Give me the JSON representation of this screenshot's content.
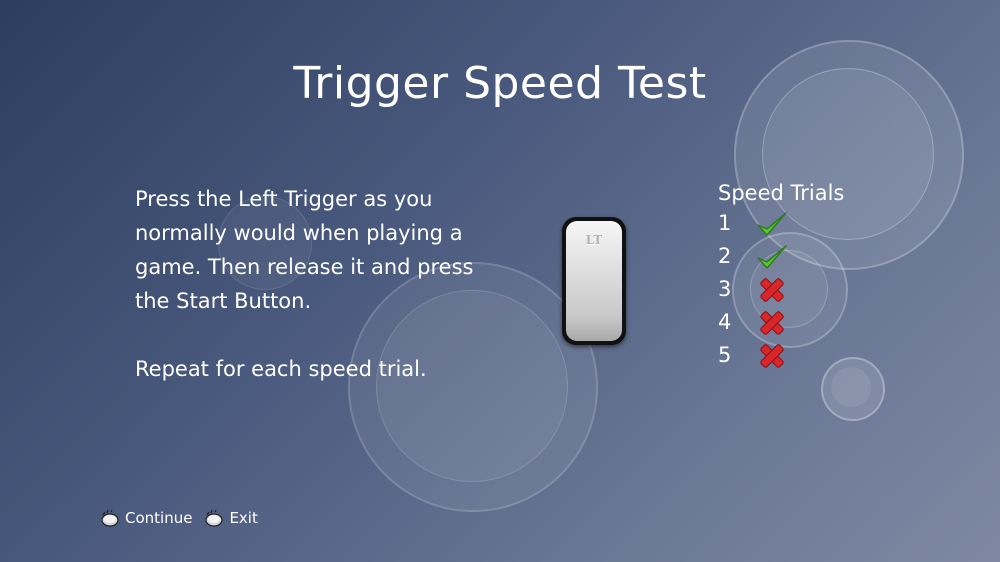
{
  "screen": {
    "title": "Trigger Speed Test"
  },
  "instructions": {
    "line1": "Press the Left Trigger as you normally would when playing a game. Then release it and press the Start Button.",
    "line2": "Repeat for each speed trial."
  },
  "trigger": {
    "label": "LT",
    "icon": "left-trigger-icon"
  },
  "trials": {
    "heading": "Speed Trials",
    "items": [
      {
        "number": "1",
        "status": "pass"
      },
      {
        "number": "2",
        "status": "pass"
      },
      {
        "number": "3",
        "status": "fail"
      },
      {
        "number": "4",
        "status": "fail"
      },
      {
        "number": "5",
        "status": "fail"
      }
    ]
  },
  "footer": {
    "continue_label": "Continue",
    "continue_icon": "controller-button-icon",
    "exit_label": "Exit",
    "exit_icon": "controller-button-icon"
  },
  "colors": {
    "pass": "#5cc83a",
    "fail": "#d8262b",
    "text": "#ffffff"
  }
}
